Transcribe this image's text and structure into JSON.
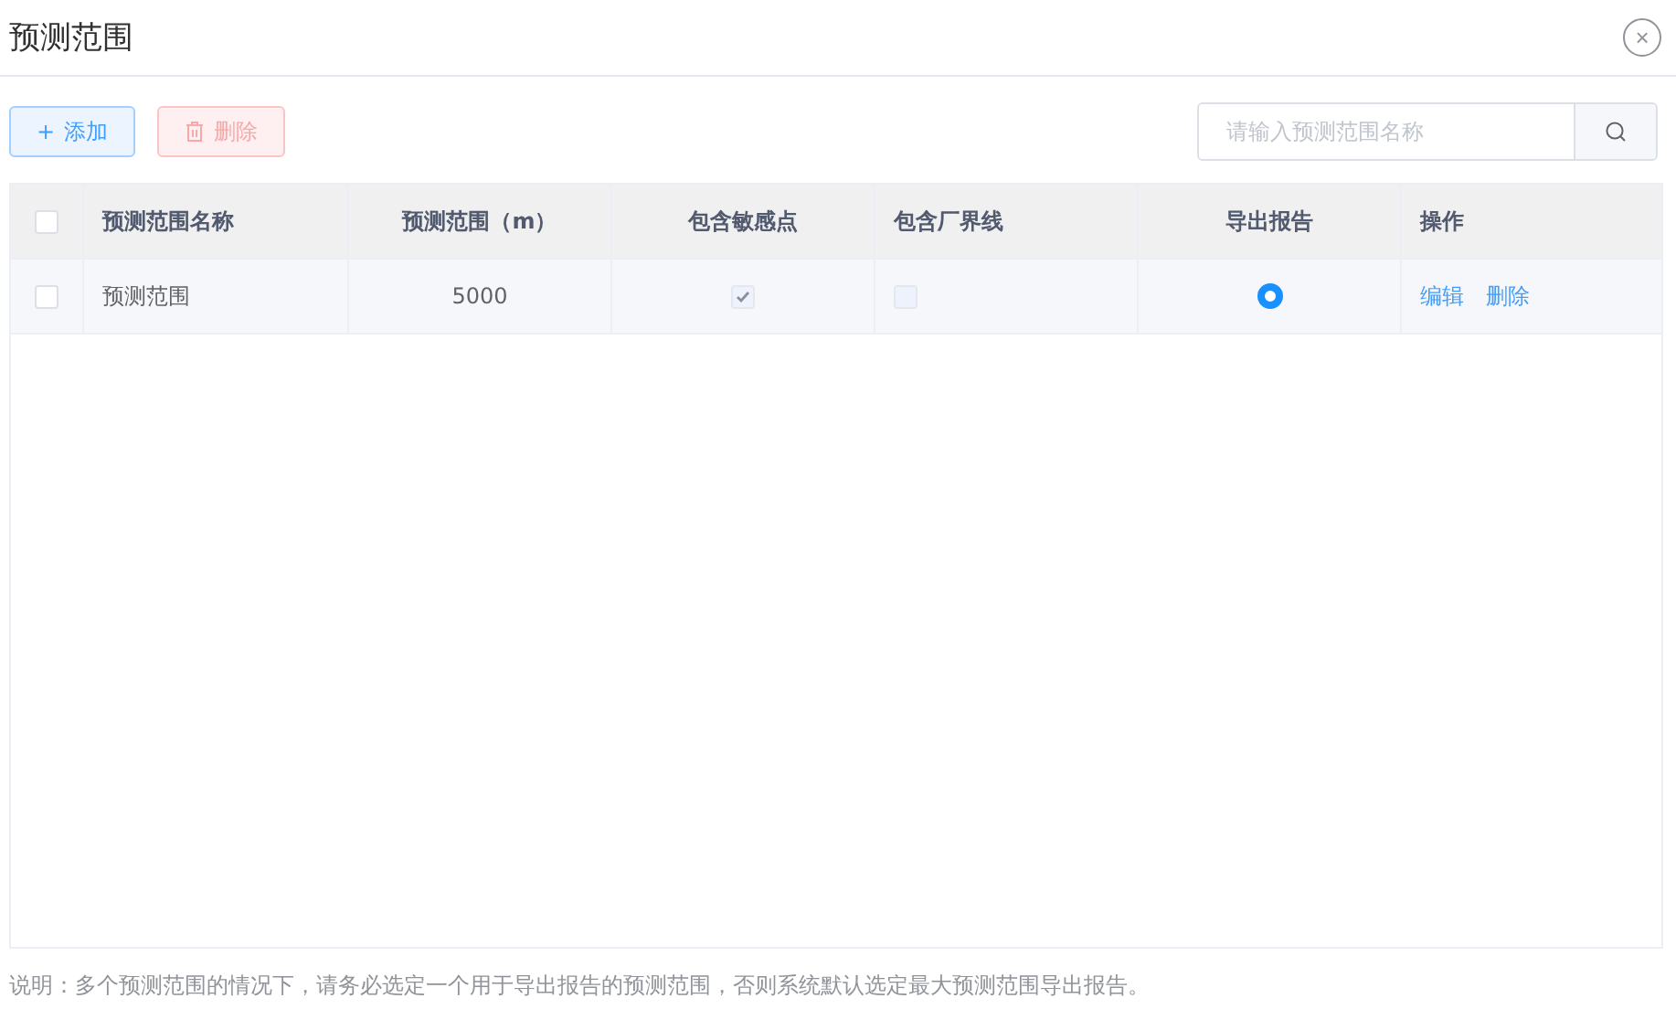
{
  "dialog": {
    "title": "预测范围",
    "close_icon": "×"
  },
  "toolbar": {
    "add_button": {
      "icon": "+",
      "label": "添加"
    },
    "delete_button": {
      "label": "删除",
      "disabled": true
    },
    "search": {
      "placeholder": "请输入预测范围名称"
    }
  },
  "table": {
    "select_all": {
      "checked": false
    },
    "columns": [
      {
        "label": "预测范围名称"
      },
      {
        "label": "预测范围（m）"
      },
      {
        "label": "包含敏感点"
      },
      {
        "label": "包含厂界线"
      },
      {
        "label": "导出报告"
      },
      {
        "label": "操作"
      }
    ],
    "rows": [
      {
        "checked": false,
        "name": "预测范围",
        "range": "5000",
        "sensitive_points": true,
        "boundary_line": false,
        "export_report": {
          "selected": true
        },
        "actions": [
          "编辑",
          "删除"
        ]
      }
    ]
  },
  "note": "说明：多个预测范围的情况下，请务必选定一个用于导出报告的预测范围，否则系统默认选定最大预测范围导出报告。"
}
